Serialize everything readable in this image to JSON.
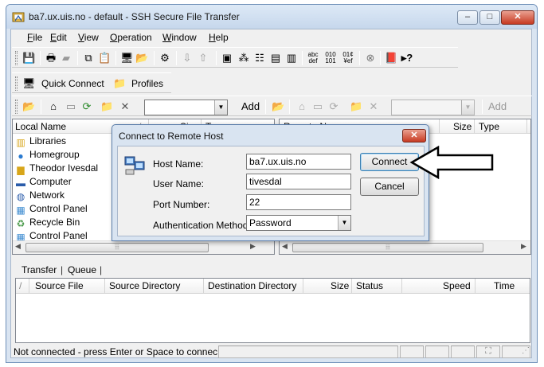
{
  "window": {
    "title": "ba7.ux.uis.no - default - SSH Secure File Transfer",
    "buttons": {
      "minimize": "–",
      "maximize": "□",
      "close": "✕"
    }
  },
  "menu": {
    "items": [
      {
        "hotkey": "F",
        "rest": "ile"
      },
      {
        "hotkey": "E",
        "rest": "dit"
      },
      {
        "hotkey": "V",
        "rest": "iew"
      },
      {
        "hotkey": "O",
        "rest": "peration"
      },
      {
        "hotkey": "W",
        "rest": "indow"
      },
      {
        "hotkey": "H",
        "rest": "elp"
      }
    ]
  },
  "toolbar2": {
    "quick_connect": "Quick Connect",
    "profiles": "Profiles"
  },
  "toolbar3": {
    "add_left": "Add",
    "add_right": "Add"
  },
  "local_pane": {
    "columns": [
      "Local Name",
      "Size",
      "Type"
    ],
    "items": [
      {
        "icon": "libraries-icon",
        "label": "Libraries"
      },
      {
        "icon": "homegroup-icon",
        "label": "Homegroup"
      },
      {
        "icon": "user-folder-icon",
        "label": "Theodor Ivesdal"
      },
      {
        "icon": "computer-icon",
        "label": "Computer"
      },
      {
        "icon": "network-icon",
        "label": "Network"
      },
      {
        "icon": "control-panel-icon",
        "label": "Control Panel"
      },
      {
        "icon": "recycle-bin-icon",
        "label": "Recycle Bin"
      },
      {
        "icon": "control-panel-icon",
        "label": "Control Panel"
      }
    ]
  },
  "remote_pane": {
    "columns": [
      "Remote Name",
      "Size",
      "Type"
    ]
  },
  "transfer": {
    "tabs": [
      "Transfer",
      "Queue"
    ],
    "columns": [
      "Source File",
      "Source Directory",
      "Destination Directory",
      "Size",
      "Status",
      "Speed",
      "Time"
    ]
  },
  "status": {
    "text": "Not connected - press Enter or Space to connect"
  },
  "dialog": {
    "title": "Connect to Remote Host",
    "labels": {
      "host": "Host Name:",
      "user": "User Name:",
      "port": "Port Number:",
      "auth": "Authentication Method:"
    },
    "values": {
      "host": "ba7.ux.uis.no",
      "user": "tivesdal",
      "port": "22",
      "auth": "Password"
    },
    "buttons": {
      "connect": "Connect",
      "cancel": "Cancel"
    }
  },
  "colors": {
    "window_frame": "#d9e4f1",
    "close_red": "#c73a22",
    "focus_blue": "#3c7fb1"
  }
}
